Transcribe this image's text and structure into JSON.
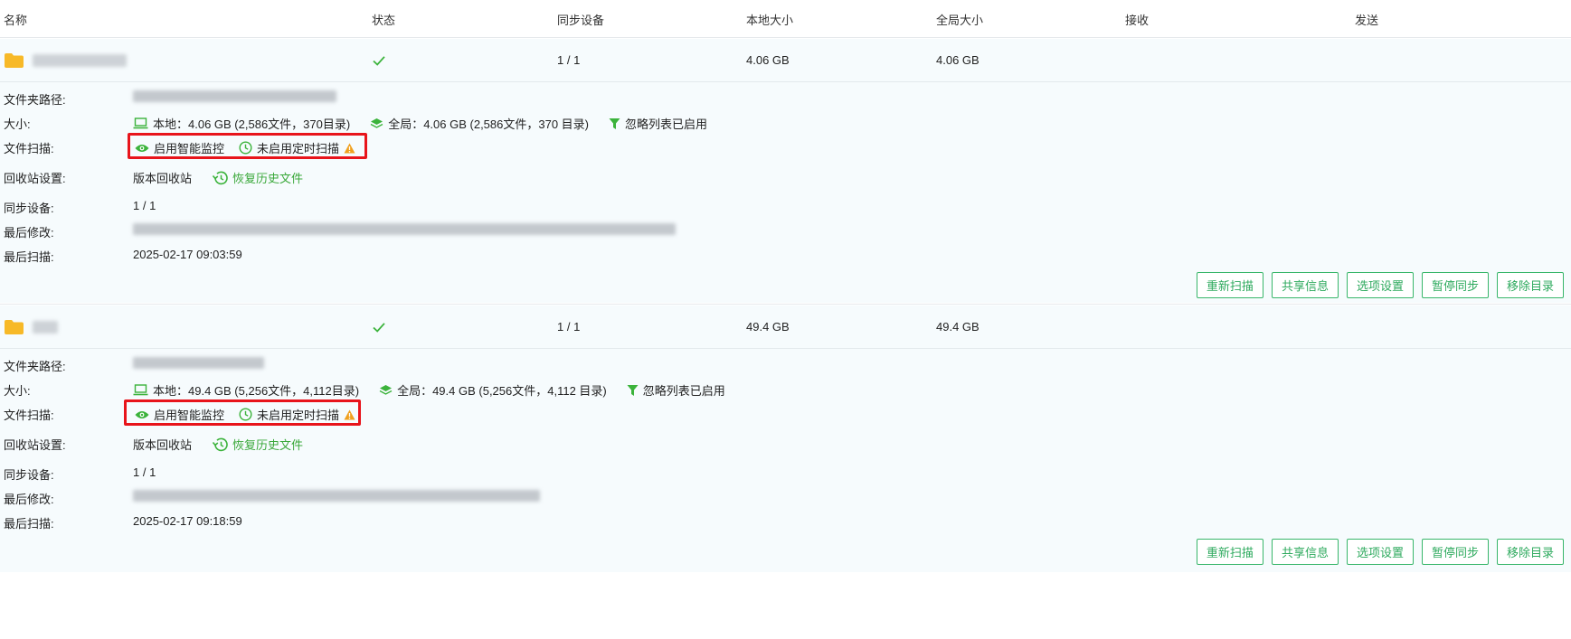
{
  "header": {
    "name": "名称",
    "status": "状态",
    "devices": "同步设备",
    "local_size": "本地大小",
    "global_size": "全局大小",
    "receive": "接收",
    "send": "发送"
  },
  "labels": {
    "path": "文件夹路径:",
    "size": "大小:",
    "scan": "文件扫描:",
    "trash": "回收站设置:",
    "devices": "同步设备:",
    "modified": "最后修改:",
    "scanned": "最后扫描:"
  },
  "folders": [
    {
      "devices": "1 / 1",
      "local_size": "4.06 GB",
      "global_size": "4.06 GB",
      "local_detail": "本地：4.06 GB (2,586文件，370目录)",
      "global_detail": "全局：4.06 GB (2,586文件，370 目录)",
      "ignore": "忽略列表已启用",
      "smart_monitor": "启用智能监控",
      "scheduled_scan": "未启用定时扫描",
      "trash_mode": "版本回收站",
      "restore": "恢复历史文件",
      "sync_devices": "1 / 1",
      "last_scan": "2025-02-17 09:03:59"
    },
    {
      "devices": "1 / 1",
      "local_size": "49.4 GB",
      "global_size": "49.4 GB",
      "local_detail": "本地：49.4 GB (5,256文件，4,112目录)",
      "global_detail": "全局：49.4 GB (5,256文件，4,112 目录)",
      "ignore": "忽略列表已启用",
      "smart_monitor": "启用智能监控",
      "scheduled_scan": "未启用定时扫描",
      "trash_mode": "版本回收站",
      "restore": "恢复历史文件",
      "sync_devices": "1 / 1",
      "last_scan": "2025-02-17 09:18:59"
    }
  ],
  "actions": {
    "rescan": "重新扫描",
    "share": "共享信息",
    "options": "选项设置",
    "pause": "暂停同步",
    "remove": "移除目录"
  },
  "colors": {
    "accent_green": "#2eaa5e",
    "check_green": "#3bb33b",
    "folder_yellow": "#f7b928",
    "highlight_red": "#e8141b",
    "warning_orange": "#f0a01e"
  }
}
